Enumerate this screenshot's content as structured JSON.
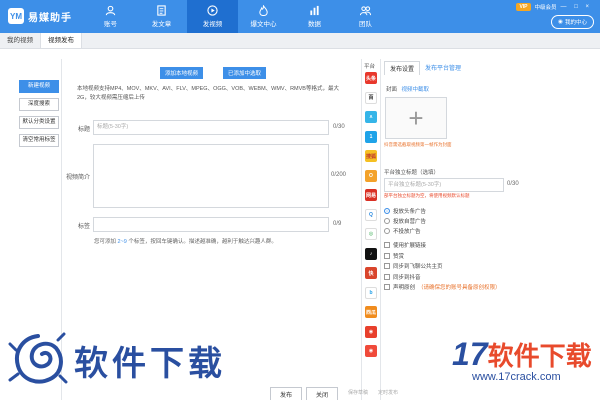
{
  "app": {
    "title": "易媒助手",
    "logo_text": "YM"
  },
  "nav": [
    {
      "label": "账号",
      "icon": "user-icon",
      "active": false
    },
    {
      "label": "发文章",
      "icon": "document-icon",
      "active": false
    },
    {
      "label": "发视频",
      "icon": "video-play-icon",
      "active": true
    },
    {
      "label": "爆文中心",
      "icon": "flame-icon",
      "active": false
    },
    {
      "label": "数据",
      "icon": "bar-chart-icon",
      "active": false
    },
    {
      "label": "团队",
      "icon": "team-icon",
      "active": false
    }
  ],
  "topright": {
    "vip": "VIP",
    "member": "中级会员",
    "controls": "— □ ×",
    "switch_label": "我的中心"
  },
  "tabs": [
    {
      "label": "我的视频",
      "active": false
    },
    {
      "label": "视频发布",
      "active": true
    }
  ],
  "left_buttons": [
    {
      "label": "新建视频",
      "primary": true
    },
    {
      "label": "深度搜索",
      "primary": false
    },
    {
      "label": "默认分类设置",
      "primary": false
    },
    {
      "label": "清空常用标签",
      "primary": false
    }
  ],
  "upload": {
    "local_label": "添加本地视频",
    "added_label": "已添加中选取"
  },
  "description": "本地视频支持MP4、MOV、MKV、AVI、FLV、MPEG、OGG、VOB、WEBM、WMV、RMVB等格式，最大2G，较大视频需压缩后上传",
  "form": {
    "title_label": "标题",
    "title_placeholder": "标题(5-30字)",
    "title_count": "0/30",
    "intro_label": "视频简介",
    "intro_count": "0/200",
    "tags_label": "标签",
    "tags_count": "0/9",
    "hint_prefix": "您可添加 ",
    "hint_range": "2~9",
    "hint_suffix": " 个标签，按回车键确认。描述越准确，越利于触达兴趣人群。"
  },
  "platforms": {
    "label": "平台",
    "items": [
      {
        "name": "toutiao",
        "text": "头条",
        "color": "#e8382c"
      },
      {
        "name": "baijia",
        "text": "百",
        "color": "#ffffff",
        "fg": "#222"
      },
      {
        "name": "dayu",
        "text": "ʌ",
        "color": "#35b5e8"
      },
      {
        "name": "yidian",
        "text": "1",
        "color": "#1fa3e8"
      },
      {
        "name": "sohu",
        "text": "搜狐",
        "color": "#f5c023",
        "fg": "#c0392b"
      },
      {
        "name": "weibo",
        "text": "O",
        "color": "#f3a22a"
      },
      {
        "name": "wangyi",
        "text": "网易",
        "color": "#d93025"
      },
      {
        "name": "qq",
        "text": "Q",
        "color": "#ffffff",
        "fg": "#2b8ae0"
      },
      {
        "name": "aiqiyi",
        "text": "◎",
        "color": "#ffffff",
        "fg": "#2ea84a"
      },
      {
        "name": "douyin",
        "text": "♪",
        "color": "#111111"
      },
      {
        "name": "kuaishou",
        "text": "快",
        "color": "#d9452c"
      },
      {
        "name": "bilibili",
        "text": "b",
        "color": "#ffffff",
        "fg": "#23a0e8"
      },
      {
        "name": "xigua",
        "text": "西瓜",
        "color": "#f08c1e"
      },
      {
        "name": "meipai",
        "text": "◉",
        "color": "#e8402c"
      },
      {
        "name": "haokan",
        "text": "◉",
        "color": "#f04a3a"
      }
    ]
  },
  "settings": {
    "tab_publish": "发布设置",
    "tab_platform": "发布平台管理",
    "cover_label": "封面",
    "cover_link": "视频中截取",
    "cover_plus": "+",
    "cover_tip": "抖音需选截取视频第一帧作为封面",
    "subtitle_label": "平台独立标题（选填）",
    "subtitle_placeholder": "平台独立标题(5-30字)",
    "subtitle_count": "0/30",
    "warn": "部平台独立标题为空，将使用视频默认标题",
    "ads": [
      {
        "label": "投放头条广告",
        "checked": true
      },
      {
        "label": "投放自营广告",
        "checked": false
      },
      {
        "label": "不投放广告",
        "checked": false
      }
    ],
    "checks": [
      {
        "label": "使用扩展链接",
        "orange": ""
      },
      {
        "label": "赞赏",
        "orange": ""
      },
      {
        "label": "同步到飞聊公共主页",
        "orange": ""
      },
      {
        "label": "同步到抖音",
        "orange": ""
      },
      {
        "label": "声明原创",
        "orange": "（请确保您的账号具备原创权限）"
      }
    ]
  },
  "bottom": {
    "publish": "发布",
    "close": "关闭",
    "save_draft": "保存草稿",
    "schedule": "定时发布"
  },
  "watermark": {
    "left_cn": "软件下载",
    "right_num": "17",
    "right_cn": "软件下载",
    "right_url": "www.17crack.com"
  }
}
